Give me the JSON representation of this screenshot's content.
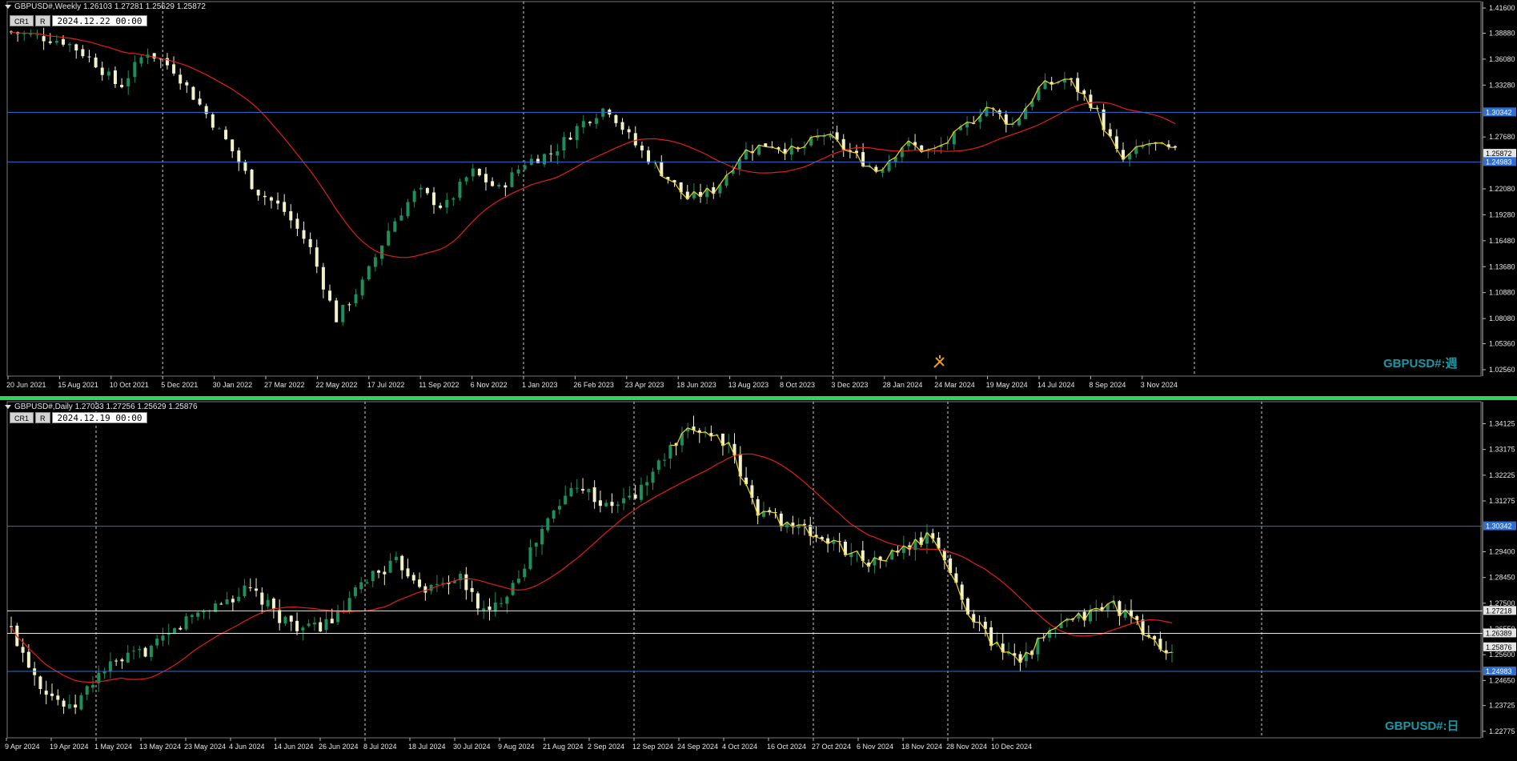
{
  "colors": {
    "background": "#000000",
    "grid": "#cfcfcf",
    "bull": "#1e8f5b",
    "bear": "#f2f2c8",
    "ma": "#e0201b",
    "zigzag": "#f0d020",
    "hline_blue": "#2e6fd6",
    "hline_white": "#e6e6e6",
    "watermark": "#1b98a5",
    "split": "#2fd35a"
  },
  "weekly": {
    "header": "GBPUSD#,Weekly  1.26103 1.27281 1.25629 1.25872",
    "btn_cr1": "CR1",
    "btn_r": "R",
    "date_value": "2024.12.22 00:00",
    "watermark": "GBPUSD#:週",
    "price_labels": [
      "1.41600",
      "1.38880",
      "1.36080",
      "1.33280",
      "1.30342",
      "1.27680",
      "1.25872",
      "1.24983",
      "1.22080",
      "1.19280",
      "1.16480",
      "1.13680",
      "1.10880",
      "1.08080",
      "1.05360",
      "1.02560"
    ],
    "marker_labels": [
      "1.30342",
      "1.25872",
      "1.24983"
    ],
    "time_labels": [
      "20 Jun 2021",
      "15 Aug 2021",
      "10 Oct 2021",
      "5 Dec 2021",
      "30 Jan 2022",
      "27 Mar 2022",
      "22 May 2022",
      "17 Jul 2022",
      "11 Sep 2022",
      "6 Nov 2022",
      "1 Jan 2023",
      "26 Feb 2023",
      "23 Apr 2023",
      "18 Jun 2023",
      "13 Aug 2023",
      "8 Oct 2023",
      "3 Dec 2023",
      "28 Jan 2024",
      "24 Mar 2024",
      "19 May 2024",
      "14 Jul 2024",
      "8 Sep 2024",
      "3 Nov 2024"
    ]
  },
  "daily": {
    "header": "GBPUSD#,Daily  1.27033 1.27256 1.25629 1.25876",
    "btn_cr1": "CR1",
    "btn_r": "R",
    "date_value": "2024.12.19 00:00",
    "watermark": "GBPUSD#:日",
    "price_labels": [
      "1.34125",
      "1.33175",
      "1.32225",
      "1.31275",
      "1.30342",
      "1.29400",
      "1.28450",
      "1.27500",
      "1.27218",
      "1.26550",
      "1.26389",
      "1.25876",
      "1.25600",
      "1.24983",
      "1.24650",
      "1.23725",
      "1.22775"
    ],
    "marker_labels": [
      "1.30342",
      "1.27218",
      "1.26389",
      "1.25876",
      "1.24983"
    ],
    "time_labels": [
      "9 Apr 2024",
      "19 Apr 2024",
      "1 May 2024",
      "13 May 2024",
      "23 May 2024",
      "4 Jun 2024",
      "14 Jun 2024",
      "26 Jun 2024",
      "8 Jul 2024",
      "18 Jul 2024",
      "30 Jul 2024",
      "9 Aug 2024",
      "21 Aug 2024",
      "2 Sep 2024",
      "12 Sep 2024",
      "24 Sep 2024",
      "4 Oct 2024",
      "16 Oct 2024",
      "27 Oct 2024",
      "6 Nov 2024",
      "18 Nov 2024",
      "28 Nov 2024",
      "10 Dec 2024"
    ]
  }
}
